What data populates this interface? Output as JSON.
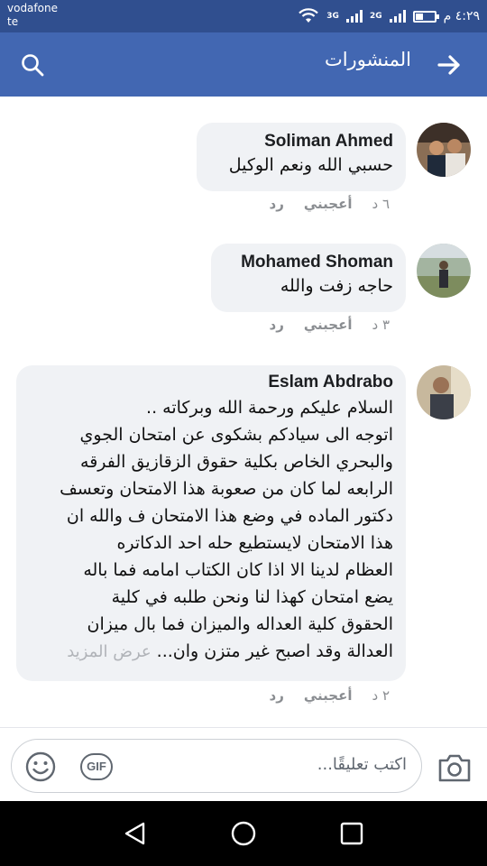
{
  "status_bar": {
    "carrier_line1": "vodafone",
    "carrier_line2": "te",
    "network1": "3G",
    "network2": "2G",
    "time": "٤:٢٩ م"
  },
  "header": {
    "title": "المنشورات",
    "icons": {
      "back": "arrow-right-icon",
      "search": "search-icon"
    }
  },
  "comments": [
    {
      "author": "Soliman Ahmed",
      "text": "حسبي الله ونعم الوكيل",
      "time": "٦ د",
      "like_label": "أعجبني",
      "reply_label": "رد"
    },
    {
      "author": "Mohamed Shoman",
      "text": "حاجه زفت والله",
      "time": "٣ د",
      "like_label": "أعجبني",
      "reply_label": "رد"
    },
    {
      "author": "Eslam Abdrabo",
      "lines": [
        "السلام عليكم ورحمة الله وبركاته ..",
        "اتوجه الى سيادكم بشكوى عن امتحان الجوي",
        "والبحري الخاص بكلية حقوق الزقازيق الفرقه",
        "الرابعه لما كان من صعوبة هذا الامتحان وتعسف",
        "دكتور الماده في وضع هذا الامتحان ف والله ان",
        "هذا الامتحان لايستطيع حله احد الدكاتره",
        "العظام لدينا الا اذا كان الكتاب امامه فما باله",
        "يضع امتحان كهذا لنا ونحن طلبه في كلية",
        "الحقوق كلية العداله والميزان فما بال ميزان",
        "العدالة وقد اصبح غير متزن وان..."
      ],
      "see_more": "عرض المزيد",
      "time": "٢ د",
      "like_label": "أعجبني",
      "reply_label": "رد"
    }
  ],
  "composer": {
    "placeholder": "اكتب تعليقًا...",
    "gif_label": "GIF"
  },
  "colors": {
    "status_bar": "#304f8f",
    "header": "#4267b2",
    "bubble": "#f0f2f5",
    "meta_text": "#8a8d91"
  }
}
